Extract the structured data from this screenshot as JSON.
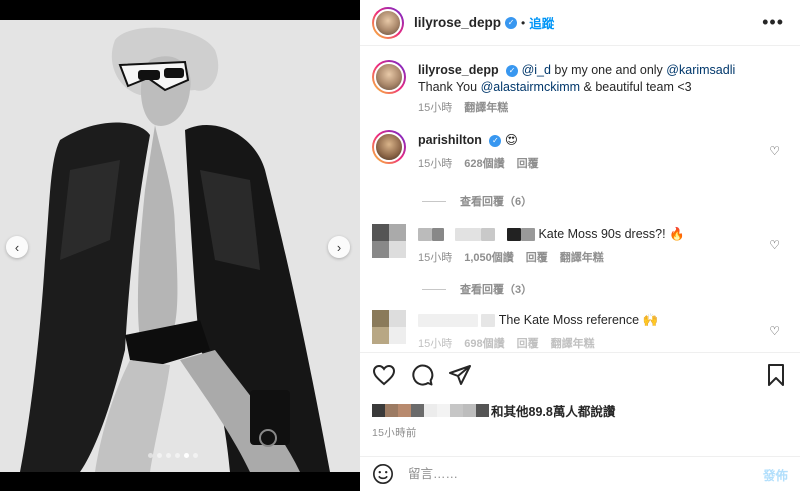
{
  "post": {
    "username": "lilyrose_depp",
    "follow_label": "追蹤",
    "more_label": "•••",
    "separator": "•"
  },
  "media": {
    "prev_label": "‹",
    "next_label": "›",
    "slide_count": 6,
    "active_slide": 5
  },
  "caption": {
    "username": "lilyrose_depp",
    "mention_1": "@i_d",
    "text_1": " by my one and only ",
    "mention_2": "@karimsadli",
    "text_2": "Thank You ",
    "mention_3": "@alastairmckimm",
    "text_3": " & beautiful team <3",
    "time": "15小時",
    "translate": "翻譯年糕"
  },
  "comments": [
    {
      "username": "parishilton",
      "text": "😍",
      "time": "15小時",
      "likes": "628個讚",
      "reply": "回覆",
      "replies_toggle": "查看回覆（6）"
    },
    {
      "text": "Kate Moss 90s dress?! 🔥",
      "time": "15小時",
      "likes": "1,050個讚",
      "reply": "回覆",
      "translate": "翻譯年糕",
      "replies_toggle": "查看回覆（3）"
    },
    {
      "text": "The Kate Moss reference 🙌",
      "time": "15小時",
      "likes": "698個讚",
      "reply": "回覆",
      "translate": "翻譯年糕"
    }
  ],
  "likes": {
    "text": "和其他89.8萬人都說讚"
  },
  "timestamp": "15小時前",
  "comment_box": {
    "placeholder": "留言……",
    "post_label": "發佈"
  },
  "colors": {
    "link": "#00376b",
    "follow": "#0095f6",
    "verified": "#3897f0",
    "muted": "#8e8e8e"
  }
}
